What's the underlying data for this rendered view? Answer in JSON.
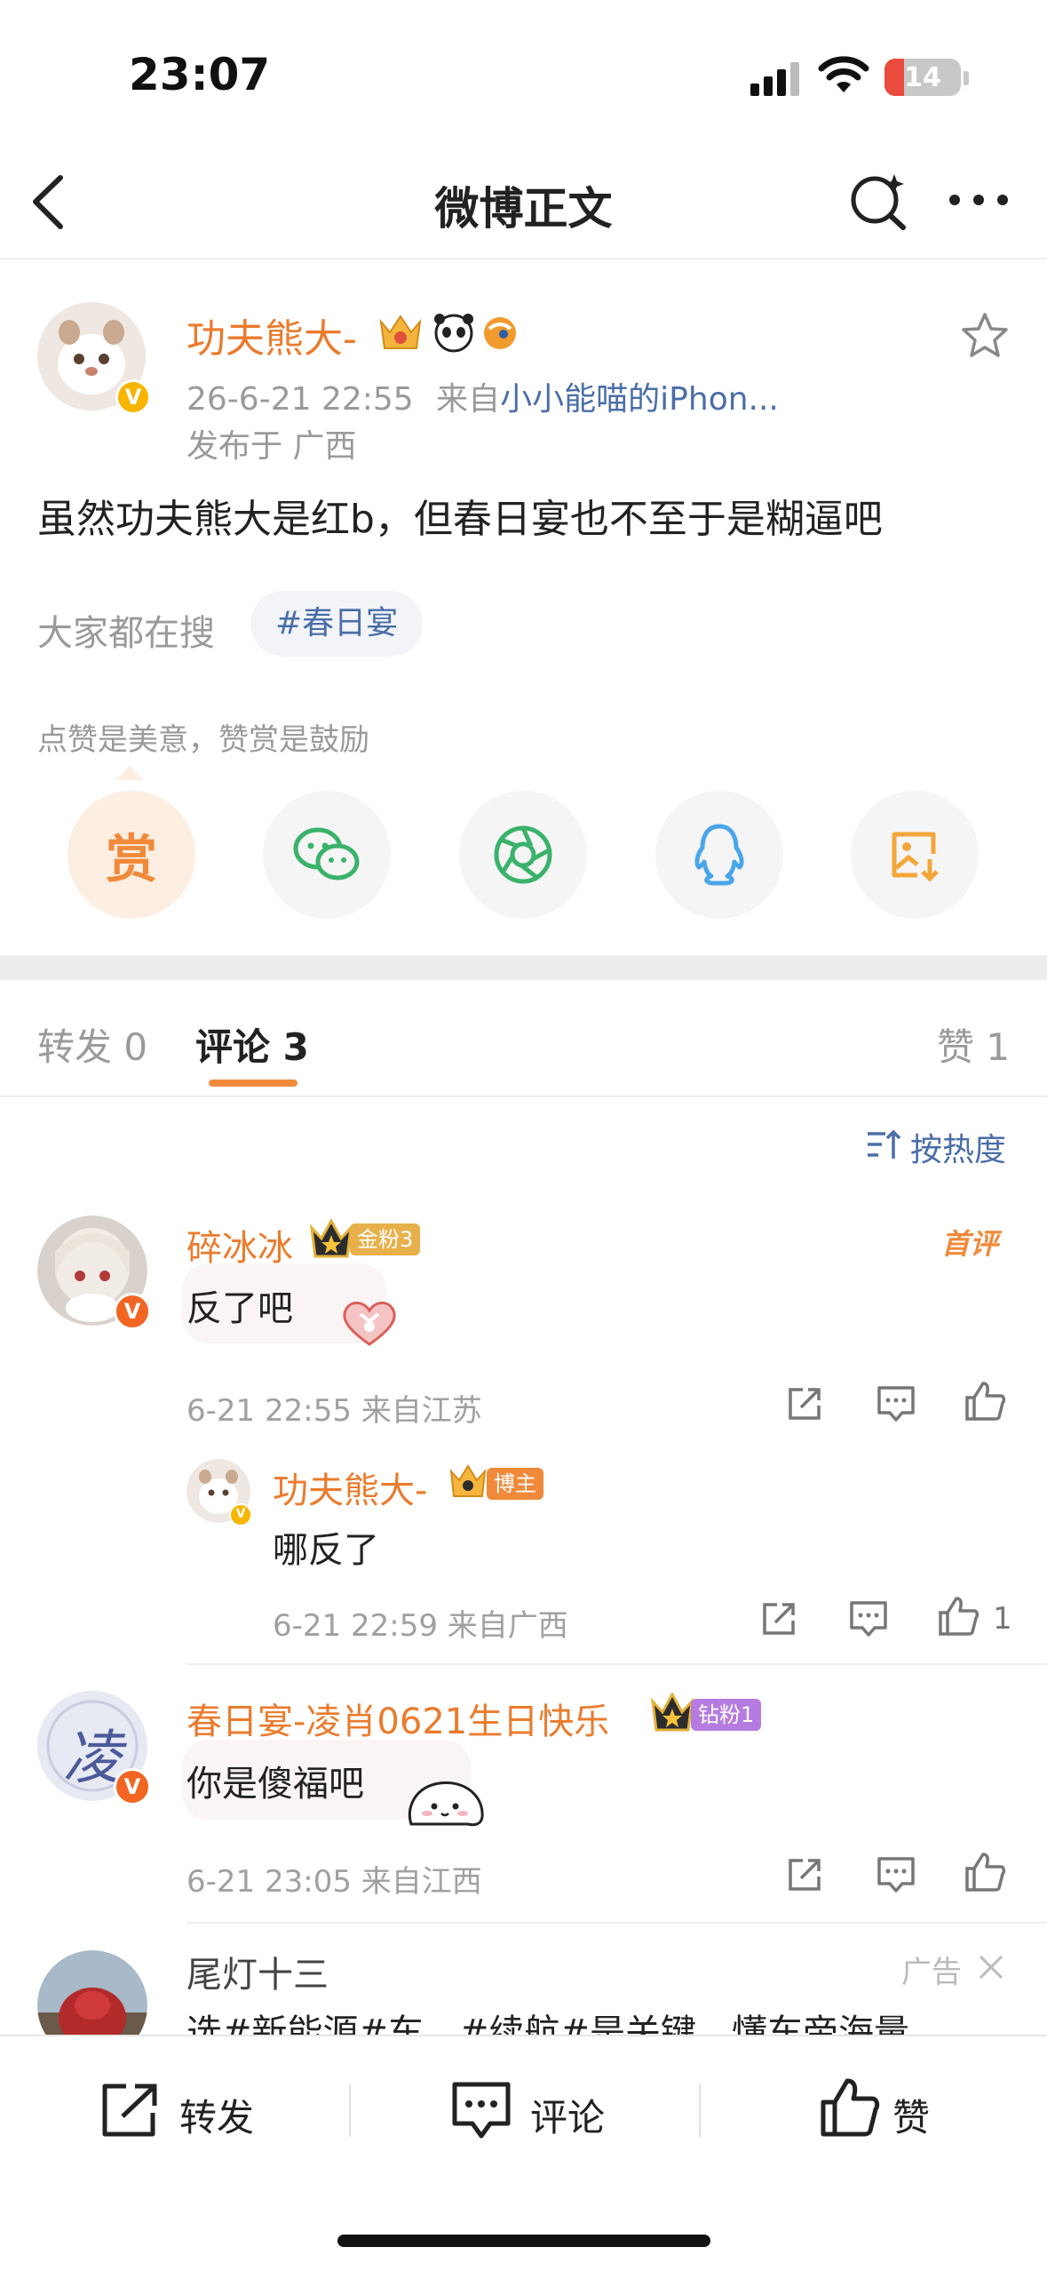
{
  "status_bar": {
    "time": "23:07",
    "battery": "14"
  },
  "nav": {
    "title": "微博正文"
  },
  "post": {
    "author": "功夫熊大-",
    "timestamp": "26-6-21 22:55",
    "source_prefix": "来自",
    "source_device": "小小能喵的iPhon...",
    "location": "发布于 广西",
    "text": "虽然功夫熊大是红b，但春日宴也不至于是糊逼吧",
    "search_label": "大家都在搜",
    "hashtag": "#春日宴",
    "reward_tip": "点赞是美意，赞赏是鼓励",
    "reward_char": "赏"
  },
  "tabs": {
    "repost": "转发 0",
    "comments": "评论 3",
    "likes": "赞 1",
    "sort": "按热度"
  },
  "comments": [
    {
      "name": "碎冰冰",
      "badge": "金粉3",
      "first_tag": "首评",
      "text": "反了吧",
      "meta": "6-21 22:55  来自江苏",
      "reply": {
        "name": "功夫熊大-",
        "badge": "博主",
        "text": "哪反了",
        "meta": "6-21 22:59  来自广西",
        "like_count": "1"
      }
    },
    {
      "name": "春日宴-凌肖0621生日快乐",
      "badge": "钻粉1",
      "avatar_char": "凌",
      "text": "你是傻福吧",
      "meta": "6-21 23:05  来自江西"
    }
  ],
  "ad": {
    "name": "尾灯十三",
    "label": "广告",
    "text": "选#新能源#车，#续航#是关键，懂车帝海量"
  },
  "bottom_bar": {
    "repost": "转发",
    "comment": "评论",
    "like": "赞"
  },
  "colors": {
    "accent": "#f08a3a",
    "name": "#eb7b2d",
    "link": "#4a6ea8"
  }
}
